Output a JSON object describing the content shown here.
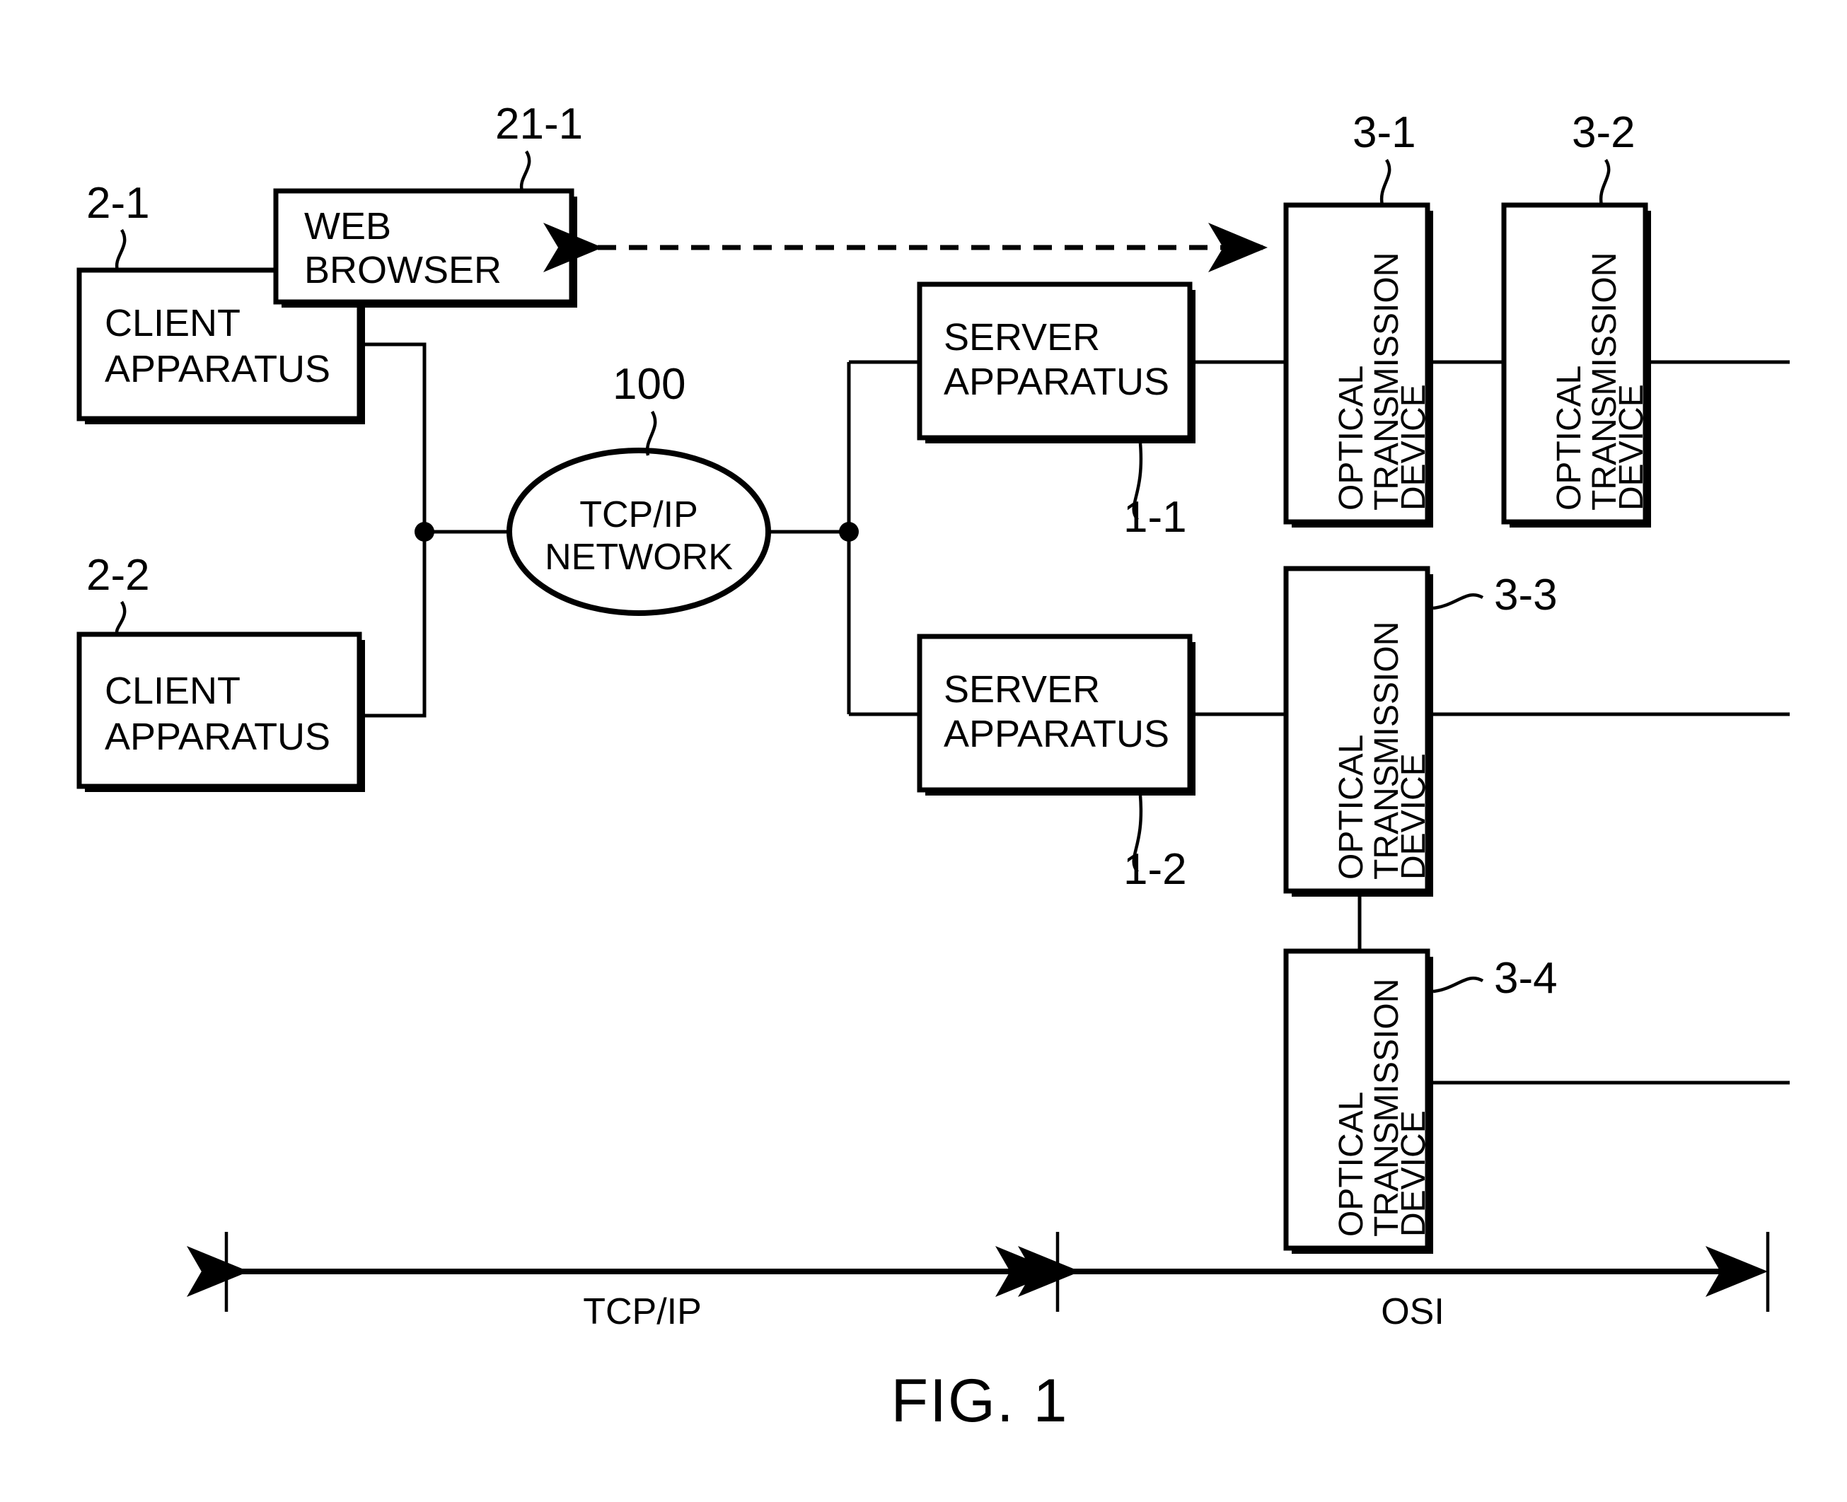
{
  "figure": {
    "caption": "FIG. 1",
    "title": "FIG. 1"
  },
  "nodes": {
    "web_browser": {
      "label_line1": "WEB",
      "label_line2": "BROWSER",
      "ref": "21-1"
    },
    "client_1": {
      "label_line1": "CLIENT",
      "label_line2": "APPARATUS",
      "ref": "2-1"
    },
    "client_2": {
      "label_line1": "CLIENT",
      "label_line2": "APPARATUS",
      "ref": "2-2"
    },
    "network": {
      "label_line1": "TCP/IP",
      "label_line2": "NETWORK",
      "ref": "100"
    },
    "server_1": {
      "label_line1": "SERVER",
      "label_line2": "APPARATUS",
      "ref": "1-1"
    },
    "server_2": {
      "label_line1": "SERVER",
      "label_line2": "APPARATUS",
      "ref": "1-2"
    },
    "otd_1": {
      "label_line1": "OPTICAL",
      "label_line2": "TRANSMISSION",
      "label_line3": "DEVICE",
      "ref": "3-1"
    },
    "otd_2": {
      "label_line1": "OPTICAL",
      "label_line2": "TRANSMISSION",
      "label_line3": "DEVICE",
      "ref": "3-2"
    },
    "otd_3": {
      "label_line1": "OPTICAL",
      "label_line2": "TRANSMISSION",
      "label_line3": "DEVICE",
      "ref": "3-3"
    },
    "otd_4": {
      "label_line1": "OPTICAL",
      "label_line2": "TRANSMISSION",
      "label_line3": "DEVICE",
      "ref": "3-4"
    }
  },
  "scale": {
    "left_label": "TCP/IP",
    "right_label": "OSI"
  },
  "colors": {
    "ink": "#000000",
    "paper": "#ffffff"
  }
}
